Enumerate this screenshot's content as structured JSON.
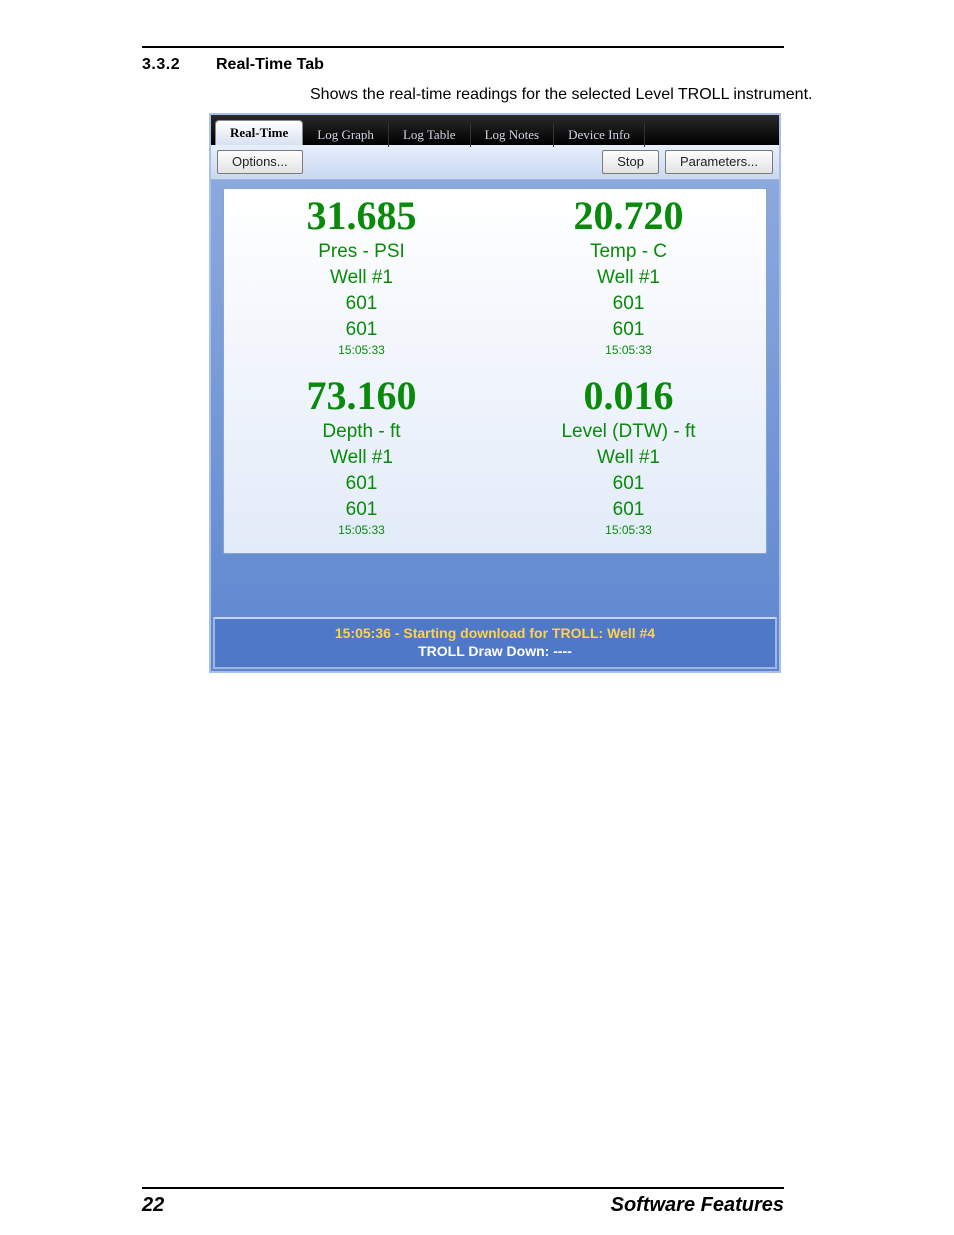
{
  "doc": {
    "section_number": "3.3.2",
    "section_title": "Real-Time Tab",
    "caption": "Shows the real-time readings for the selected Level TROLL instrument.",
    "page_number": "22",
    "footer": "Software Features"
  },
  "tabs": {
    "realtime": "Real-Time",
    "loggraph": "Log Graph",
    "logtable": "Log Table",
    "lognotes": "Log Notes",
    "deviceinfo": "Device Info"
  },
  "toolbar": {
    "options": "Options...",
    "stop": "Stop",
    "parameters": "Parameters..."
  },
  "readings": [
    {
      "value": "31.685",
      "label": "Pres - PSI",
      "well": "Well #1",
      "n1": "601",
      "n2": "601",
      "time": "15:05:33"
    },
    {
      "value": "20.720",
      "label": "Temp - C",
      "well": "Well #1",
      "n1": "601",
      "n2": "601",
      "time": "15:05:33"
    },
    {
      "value": "73.160",
      "label": "Depth - ft",
      "well": "Well #1",
      "n1": "601",
      "n2": "601",
      "time": "15:05:33"
    },
    {
      "value": "0.016",
      "label": "Level (DTW) - ft",
      "well": "Well #1",
      "n1": "601",
      "n2": "601",
      "time": "15:05:33"
    }
  ],
  "status": {
    "line1": "15:05:36 - Starting download for TROLL: Well #4",
    "line2": "TROLL Draw Down: ----"
  }
}
